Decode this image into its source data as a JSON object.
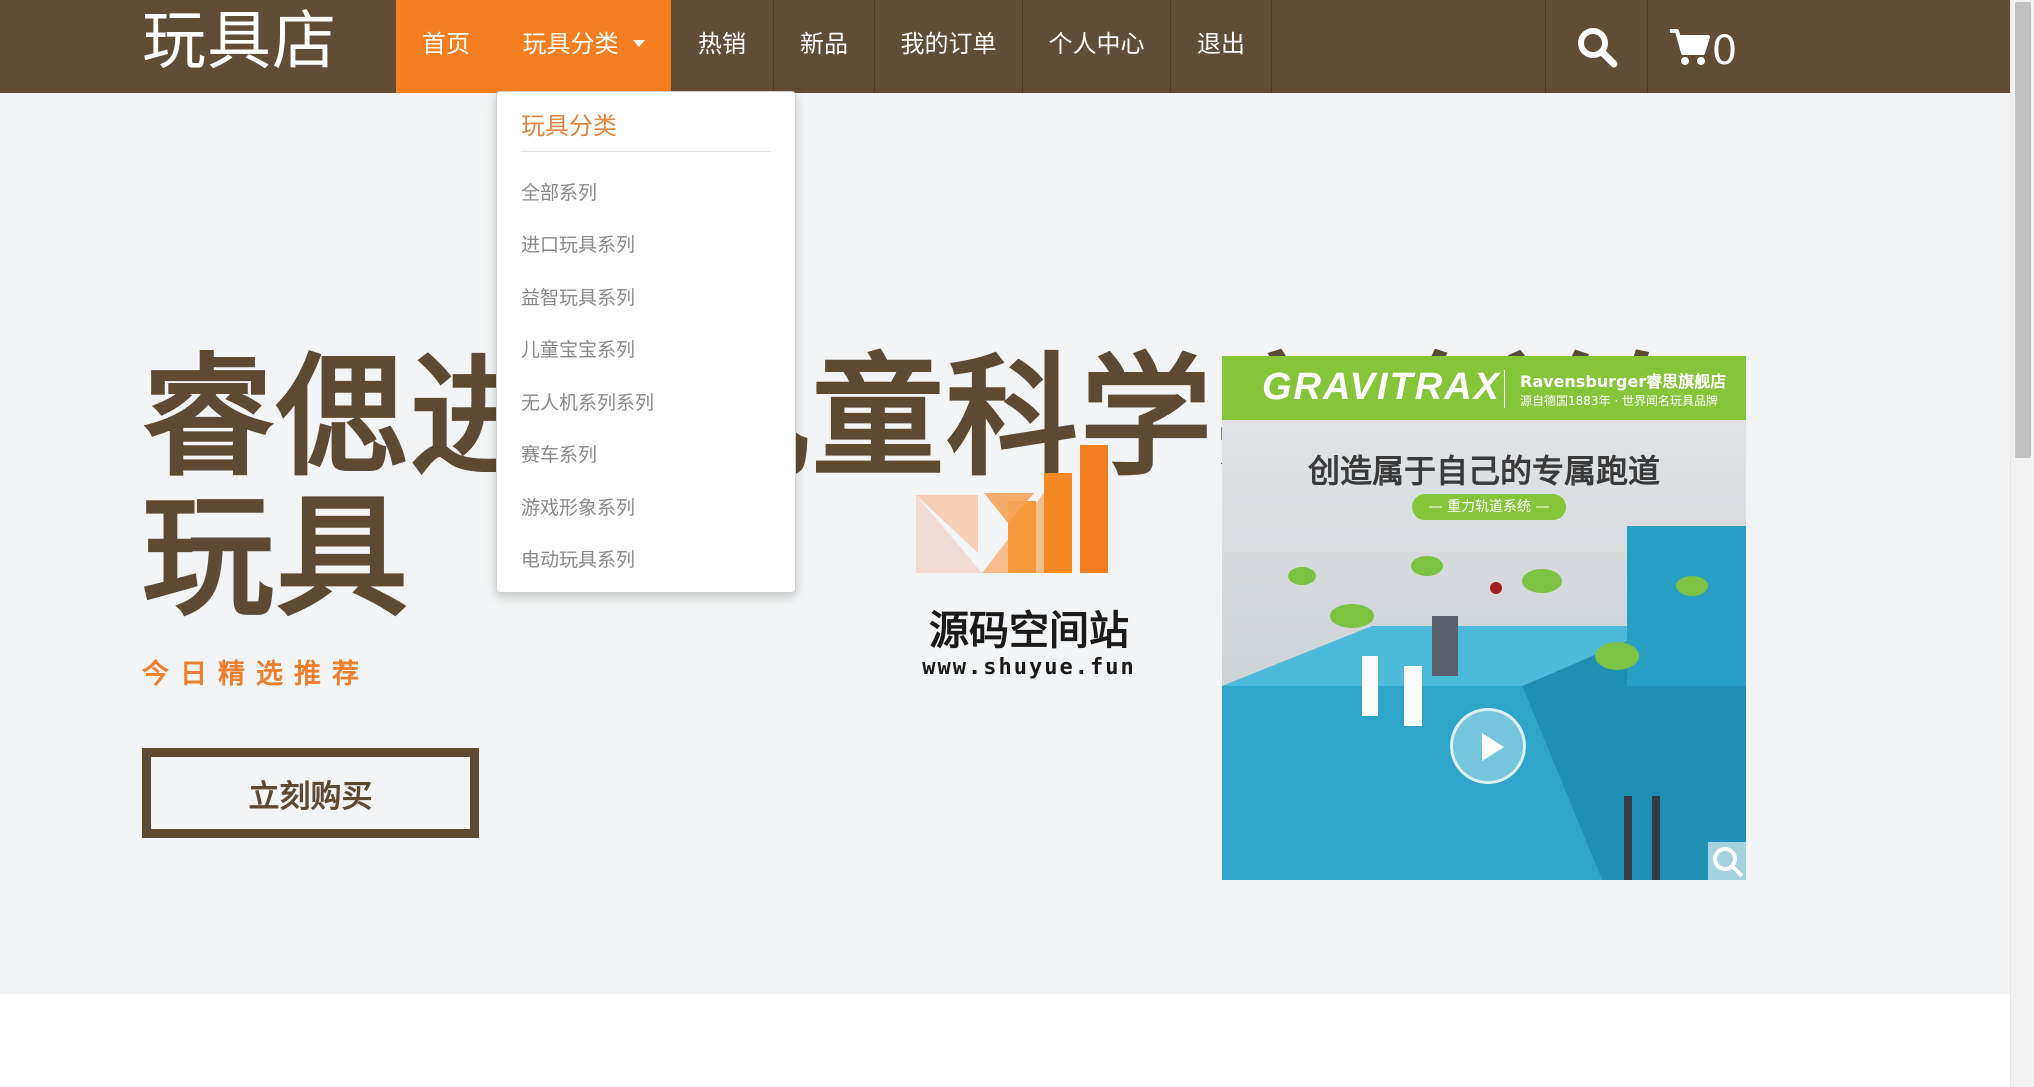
{
  "brand": "玩具店",
  "nav": {
    "items": [
      {
        "label": "首页"
      },
      {
        "label": "玩具分类"
      },
      {
        "label": "热销"
      },
      {
        "label": "新品"
      },
      {
        "label": "我的订单"
      },
      {
        "label": "个人中心"
      },
      {
        "label": "退出"
      }
    ],
    "search_icon": "search-icon",
    "cart_icon": "cart-icon",
    "cart_count": "0",
    "colors": {
      "bar": "#614c35",
      "active": "#f57e20"
    }
  },
  "dropdown": {
    "header": "玩具分类",
    "items": [
      {
        "label": "全部系列"
      },
      {
        "label": "进口玩具系列"
      },
      {
        "label": "益智玩具系列"
      },
      {
        "label": "儿童宝宝系列"
      },
      {
        "label": "无人机系列系列"
      },
      {
        "label": "赛车系列"
      },
      {
        "label": "游戏形象系列"
      },
      {
        "label": "电动玩具系列"
      }
    ]
  },
  "hero": {
    "title": "睿偲进口儿童科学实验益智玩具",
    "subtitle": "今日精选推荐",
    "buy_button": "立刻购买"
  },
  "watermark": {
    "name": "源码空间站",
    "url": "www.shuyue.fun"
  },
  "product": {
    "logo": "GRAVITRAX",
    "brand": "Ravensburger睿思旗舰店",
    "brand_sub": "源自德国1883年 · 世界闻名玩具品牌",
    "headline": "创造属于自己的专属跑道",
    "tag": "— 重力轨道系统 —",
    "play_icon": "play-icon",
    "zoom_icon": "zoom-icon"
  }
}
